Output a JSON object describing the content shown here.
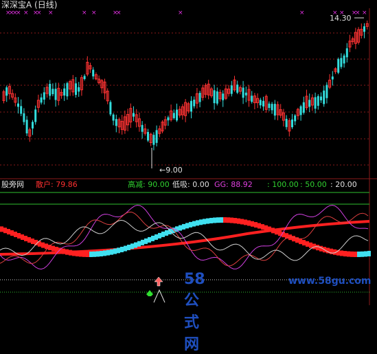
{
  "title": "深深宝A (日线)",
  "price_labels": {
    "high": "14.30",
    "low": "9.00"
  },
  "indicator_bar": {
    "brand": "股旁网",
    "items": [
      {
        "label": "散户: 79.86",
        "color": "#ff3030"
      },
      {
        "label": "高减: 90.00",
        "color": "#30d030"
      },
      {
        "label": "低吸: 0.00",
        "color": "#e0e0e0"
      },
      {
        "label": "GG: 88.92",
        "color": "#e040e0"
      },
      {
        "label": ": 100.00",
        "color": "#30d030"
      },
      {
        "label": ": 50.00",
        "color": "#30d030"
      },
      {
        "label": ": 20.00",
        "color": "#e0e0e0"
      }
    ]
  },
  "watermark": {
    "big": "58公式网",
    "small": "www.58gu.com"
  },
  "colors": {
    "up": "#ff3333",
    "down": "#33dddd",
    "grid": "#8b1a1a",
    "marker": "#e030e0"
  }
}
